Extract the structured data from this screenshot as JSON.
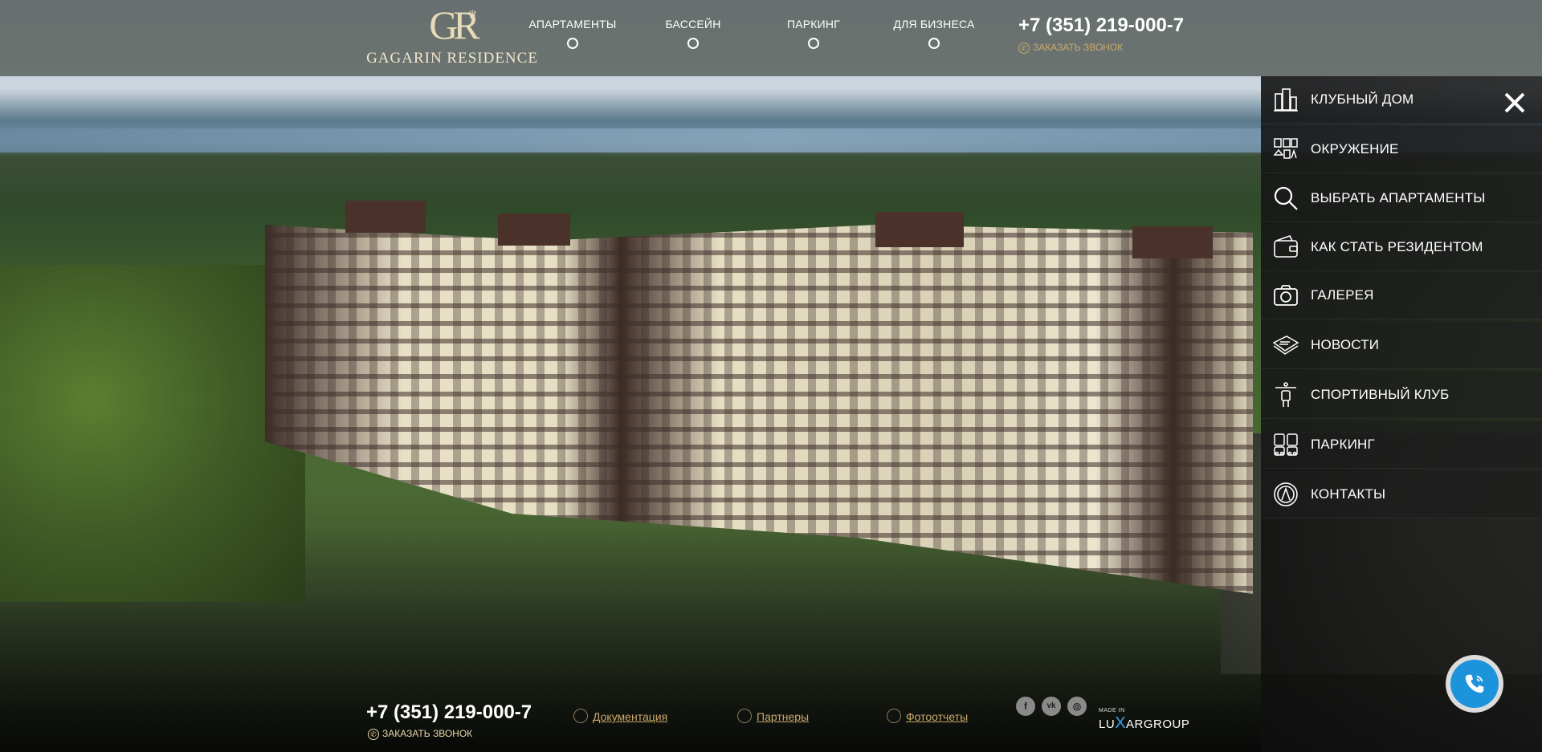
{
  "brand": {
    "logo_mark": "GR",
    "logo_text": "GAGARIN RESIDENCE"
  },
  "header": {
    "nav": [
      {
        "label": "АПАРТАМЕНТЫ"
      },
      {
        "label": "БАССЕЙН"
      },
      {
        "label": "ПАРКИНГ"
      },
      {
        "label": "ДЛЯ БИЗНЕСА"
      }
    ],
    "phone": "+7 (351) 219-000-7",
    "callback": "ЗАКАЗАТЬ ЗВОНОК"
  },
  "side_menu": {
    "items": [
      {
        "label": "КЛУБНЫЙ ДОМ",
        "icon": "building-icon"
      },
      {
        "label": "ОКРУЖЕНИЕ",
        "icon": "surroundings-icon"
      },
      {
        "label": "ВЫБРАТЬ АПАРТАМЕНТЫ",
        "icon": "search-icon"
      },
      {
        "label": "КАК СТАТЬ РЕЗИДЕНТОМ",
        "icon": "wallet-icon"
      },
      {
        "label": "ГАЛЕРЕЯ",
        "icon": "camera-icon"
      },
      {
        "label": "НОВОСТИ",
        "icon": "newspaper-icon"
      },
      {
        "label": "СПОРТИВНЫЙ КЛУБ",
        "icon": "fitness-icon"
      },
      {
        "label": "ПАРКИНГ",
        "icon": "parking-icon"
      },
      {
        "label": "КОНТАКТЫ",
        "icon": "compass-icon"
      }
    ]
  },
  "footer": {
    "phone": "+7 (351) 219-000-7",
    "callback": "ЗАКАЗАТЬ ЗВОНОК",
    "links": [
      {
        "label": "Документация",
        "icon": "document-icon"
      },
      {
        "label": "Партнеры",
        "icon": "partners-icon"
      },
      {
        "label": "Фотоотчеты",
        "icon": "camera-icon"
      }
    ],
    "social": [
      {
        "label": "f",
        "icon": "facebook-icon"
      },
      {
        "label": "vk",
        "icon": "vk-icon"
      },
      {
        "label": "◎",
        "icon": "instagram-icon"
      }
    ],
    "made_in": "MADE IN",
    "luxar_pre": "LU",
    "luxar_x": "X",
    "luxar_post": "ARGROUP"
  },
  "colors": {
    "gold": "#c8a96a",
    "accent_blue": "#1d93db",
    "menu_bg": "#1e1e1e"
  }
}
